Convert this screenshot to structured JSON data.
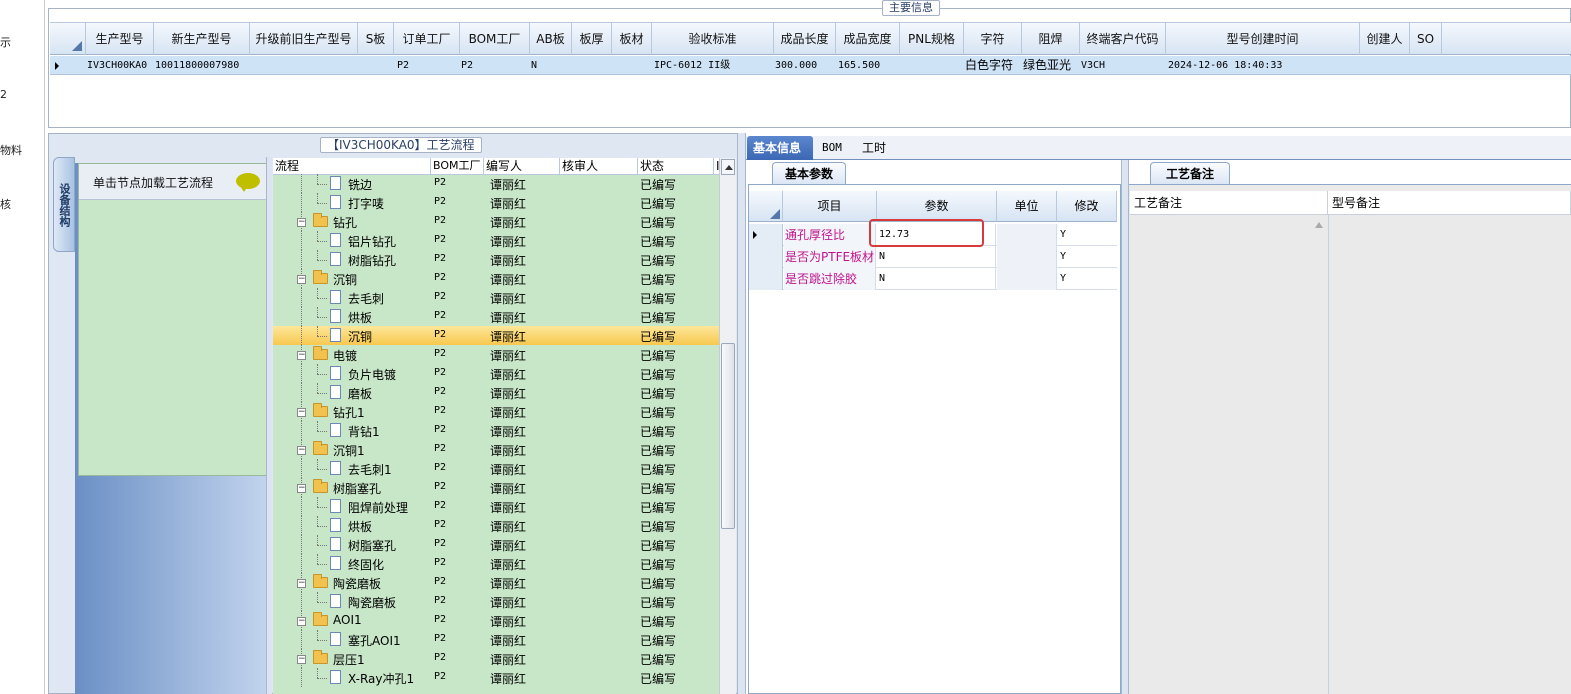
{
  "left_nav": [
    "示",
    "2",
    "物料",
    "核"
  ],
  "main_group_title": "主要信息",
  "main_table": {
    "headers": [
      "生产型号",
      "新生产型号",
      "升级前旧生产型号",
      "S板",
      "订单工厂",
      "BOM工厂",
      "AB板",
      "板厚",
      "板材",
      "验收标准",
      "成品长度",
      "成品宽度",
      "PNL规格",
      "字符",
      "阻焊",
      "终端客户代码",
      "型号创建时间",
      "创建人",
      "SO"
    ],
    "row": [
      "IV3CH00KA0",
      "10011800007980",
      "",
      "",
      "P2",
      "P2",
      "N",
      "",
      "",
      "IPC-6012 II级",
      "300.000",
      "165.500",
      "",
      "白色字符",
      "绿色亚光",
      "V3CH",
      "2024-12-06 18:40:33",
      "",
      ""
    ]
  },
  "flow_group_title": "【IV3CH00KA0】工艺流程",
  "device_tab": "设备结构",
  "tree_hint": "单击节点加载工艺流程",
  "flow_table": {
    "headers": [
      "流程",
      "BOM工厂",
      "编写人",
      "核审人",
      "状态",
      "I"
    ],
    "rows": [
      {
        "name": "铣边",
        "level": 2,
        "bom": "P2",
        "writer": "谭丽红",
        "status": "已编写"
      },
      {
        "name": "打字唛",
        "level": 2,
        "bom": "P2",
        "writer": "谭丽红",
        "status": "已编写"
      },
      {
        "name": "钻孔",
        "level": 1,
        "bom": "P2",
        "writer": "谭丽红",
        "status": "已编写"
      },
      {
        "name": "铝片钻孔",
        "level": 2,
        "bom": "P2",
        "writer": "谭丽红",
        "status": "已编写"
      },
      {
        "name": "树脂钻孔",
        "level": 2,
        "bom": "P2",
        "writer": "谭丽红",
        "status": "已编写"
      },
      {
        "name": "沉铜",
        "level": 1,
        "bom": "P2",
        "writer": "谭丽红",
        "status": "已编写"
      },
      {
        "name": "去毛刺",
        "level": 2,
        "bom": "P2",
        "writer": "谭丽红",
        "status": "已编写"
      },
      {
        "name": "烘板",
        "level": 2,
        "bom": "P2",
        "writer": "谭丽红",
        "status": "已编写"
      },
      {
        "name": "沉铜",
        "level": 2,
        "bom": "P2",
        "writer": "谭丽红",
        "status": "已编写",
        "selected": true
      },
      {
        "name": "电镀",
        "level": 1,
        "bom": "P2",
        "writer": "谭丽红",
        "status": "已编写"
      },
      {
        "name": "负片电镀",
        "level": 2,
        "bom": "P2",
        "writer": "谭丽红",
        "status": "已编写"
      },
      {
        "name": "磨板",
        "level": 2,
        "bom": "P2",
        "writer": "谭丽红",
        "status": "已编写"
      },
      {
        "name": "钻孔1",
        "level": 1,
        "bom": "P2",
        "writer": "谭丽红",
        "status": "已编写"
      },
      {
        "name": "背钻1",
        "level": 2,
        "bom": "P2",
        "writer": "谭丽红",
        "status": "已编写"
      },
      {
        "name": "沉铜1",
        "level": 1,
        "bom": "P2",
        "writer": "谭丽红",
        "status": "已编写"
      },
      {
        "name": "去毛刺1",
        "level": 2,
        "bom": "P2",
        "writer": "谭丽红",
        "status": "已编写"
      },
      {
        "name": "树脂塞孔",
        "level": 1,
        "bom": "P2",
        "writer": "谭丽红",
        "status": "已编写"
      },
      {
        "name": "阻焊前处理",
        "level": 2,
        "bom": "P2",
        "writer": "谭丽红",
        "status": "已编写"
      },
      {
        "name": "烘板",
        "level": 2,
        "bom": "P2",
        "writer": "谭丽红",
        "status": "已编写"
      },
      {
        "name": "树脂塞孔",
        "level": 2,
        "bom": "P2",
        "writer": "谭丽红",
        "status": "已编写"
      },
      {
        "name": "终固化",
        "level": 2,
        "bom": "P2",
        "writer": "谭丽红",
        "status": "已编写"
      },
      {
        "name": "陶瓷磨板",
        "level": 1,
        "bom": "P2",
        "writer": "谭丽红",
        "status": "已编写"
      },
      {
        "name": "陶瓷磨板",
        "level": 2,
        "bom": "P2",
        "writer": "谭丽红",
        "status": "已编写"
      },
      {
        "name": "AOI1",
        "level": 1,
        "bom": "P2",
        "writer": "谭丽红",
        "status": "已编写"
      },
      {
        "name": "塞孔AOI1",
        "level": 2,
        "bom": "P2",
        "writer": "谭丽红",
        "status": "已编写"
      },
      {
        "name": "层压1",
        "level": 1,
        "bom": "P2",
        "writer": "谭丽红",
        "status": "已编写"
      },
      {
        "name": "X-Ray冲孔1",
        "level": 2,
        "bom": "P2",
        "writer": "谭丽红",
        "status": "已编写"
      }
    ]
  },
  "right_tabs": [
    "基本信息",
    "BOM",
    "工时"
  ],
  "param_tab": "基本参数",
  "param_table": {
    "headers": [
      "项目",
      "参数",
      "单位",
      "修改"
    ],
    "rows": [
      {
        "item": "通孔厚径比",
        "value": "12.73",
        "unit": "",
        "mod": "Y"
      },
      {
        "item": "是否为PTFE板材",
        "value": "N",
        "unit": "",
        "mod": "Y"
      },
      {
        "item": "是否跳过除胶",
        "value": "N",
        "unit": "",
        "mod": "Y"
      }
    ]
  },
  "note_tab": "工艺备注",
  "note_headers": [
    "工艺备注",
    "型号备注"
  ]
}
